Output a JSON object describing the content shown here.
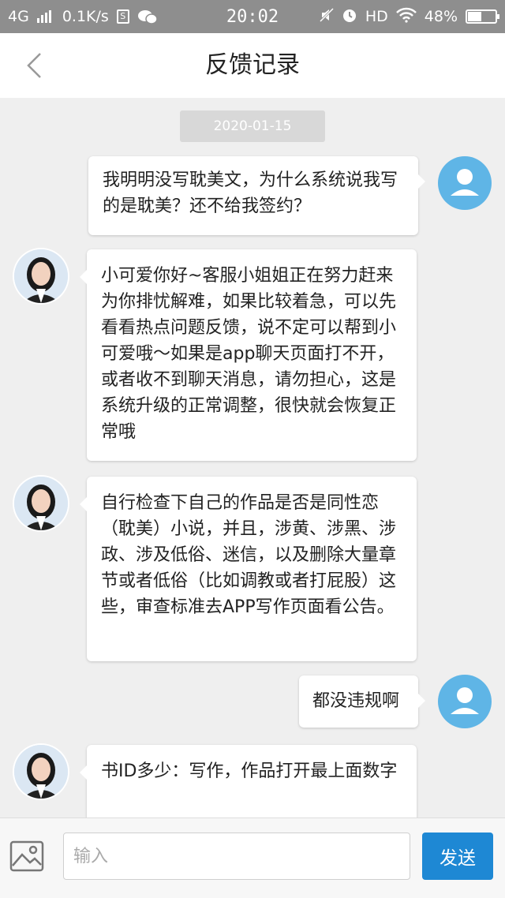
{
  "status_bar": {
    "network": "4G",
    "speed": "0.1K/s",
    "time": "20:02",
    "hd": "HD",
    "battery": "48%",
    "battery_level": 0.48,
    "icons": [
      "signal-icon",
      "sim-icon",
      "wechat-icon",
      "mute-icon",
      "alarm-icon",
      "wifi-icon",
      "battery-icon"
    ]
  },
  "header": {
    "title": "反馈记录",
    "back_icon": "chevron-left-icon"
  },
  "date_separator": "2020-01-15",
  "messages": [
    {
      "sender": "user",
      "text": "我明明没写耽美文，为什么系统说我写的是耽美？还不给我签约？"
    },
    {
      "sender": "agent",
      "text": "小可爱你好~客服小姐姐正在努力赶来为你排忧解难，如果比较着急，可以先看看热点问题反馈，说不定可以帮到小可爱哦～如果是app聊天页面打不开，或者收不到聊天消息，请勿担心，这是系统升级的正常调整，很快就会恢复正常哦"
    },
    {
      "sender": "agent",
      "text": "自行检查下自己的作品是否是同性恋（耽美）小说，并且，涉黄、涉黑、涉政、涉及低俗、迷信，以及删除大量章节或者低俗（比如调教或者打屁股）这些，审查标准去APP写作页面看公告。"
    },
    {
      "sender": "user",
      "text": "都没违规啊"
    },
    {
      "sender": "agent",
      "text": "书ID多少：写作，作品打开最上面数字"
    }
  ],
  "input_bar": {
    "placeholder": "输入",
    "send_label": "发送",
    "image_icon": "image-icon"
  },
  "colors": {
    "background": "#efefef",
    "status_bar": "#8e8e8e",
    "user_avatar": "#5fb5e6",
    "send_button": "#1e88d4"
  }
}
